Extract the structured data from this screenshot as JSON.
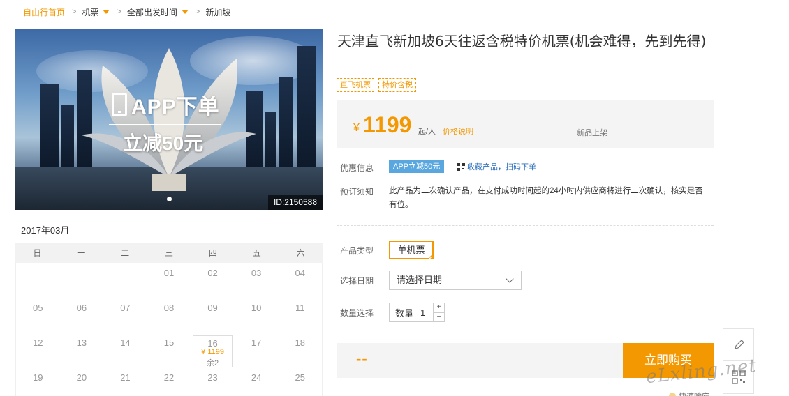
{
  "breadcrumb": {
    "home": "自由行首页",
    "items": [
      "机票",
      "全部出发时间",
      "新加坡"
    ],
    "separator": ">"
  },
  "hero": {
    "promo_main": "APP下单",
    "promo_sub": "立减50元",
    "image_id": "ID:2150588",
    "slide_count": 1,
    "active_slide": 1
  },
  "calendar": {
    "month": "2017年03月",
    "weekdays": [
      "日",
      "一",
      "二",
      "三",
      "四",
      "五",
      "六"
    ],
    "weeks": [
      [
        "",
        "",
        "",
        "01",
        "02",
        "03",
        "04"
      ],
      [
        "05",
        "06",
        "07",
        "08",
        "09",
        "10",
        "11"
      ],
      [
        "12",
        "13",
        "14",
        "15",
        "16",
        "17",
        "18"
      ],
      [
        "19",
        "20",
        "21",
        "22",
        "23",
        "24",
        "25"
      ]
    ],
    "available": {
      "day": "16",
      "price": "¥ 1199",
      "remain": "余2"
    }
  },
  "product": {
    "title": "天津直飞新加坡6天往返含税特价机票(机会难得，先到先得)",
    "tags": [
      "直飞机票",
      "特价含税"
    ],
    "price_symbol": "¥",
    "price": "1199",
    "price_unit": "起/人",
    "price_explain": "价格说明",
    "new_label": "新品上架"
  },
  "offers": {
    "label": "优惠信息",
    "promo_badge": "APP立减50元",
    "qr_link": "收藏产品，扫码下单"
  },
  "booking_notice": {
    "label": "预订须知",
    "text": "此产品为二次确认产品，在支付成功时间起的24小时内供应商将进行二次确认，核实是否有位。"
  },
  "options": {
    "type_label": "产品类型",
    "type_value": "单机票",
    "date_label": "选择日期",
    "date_placeholder": "请选择日期",
    "qty_label": "数量选择",
    "qty_inner_label": "数量",
    "qty_value": "1",
    "qty_plus": "+",
    "qty_minus": "−"
  },
  "purchase": {
    "total": "--",
    "buy_label": "立即购买"
  },
  "footer": {
    "watermark": "eLxling.net",
    "quick_reply": "快速响应"
  },
  "colors": {
    "accent": "#f39800",
    "promo_blue": "#5aa7e0",
    "link_blue": "#2a6fbd",
    "panel_gray": "#f4f4f4"
  }
}
